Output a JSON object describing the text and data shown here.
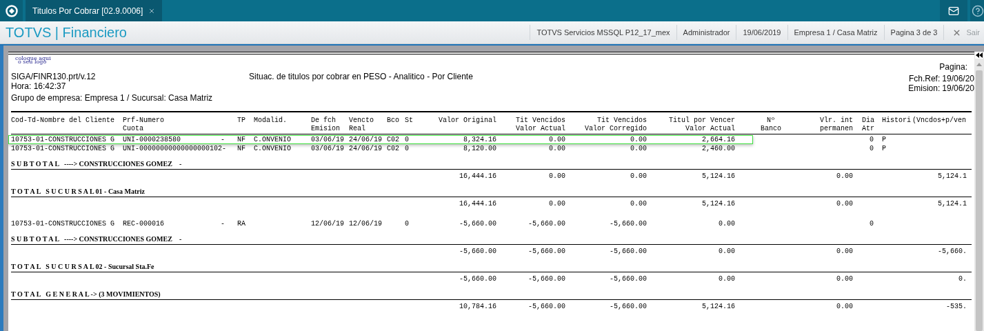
{
  "top_bar": {
    "tabs": [
      {
        "label": "Titulos Por Cobrar [02.9.0006]",
        "selected": true
      }
    ]
  },
  "header_bar": {
    "module_title": "TOTVS | Financiero",
    "info_items": [
      "TOTVS Servicios MSSQL P12_17_mex",
      "Administrador",
      "19/06/2019",
      "Empresa 1 / Casa Matriz",
      "Pagina 3 de 3"
    ],
    "exit_label": "Sair"
  },
  "report": {
    "logo_lines": [
      "coloque aqui",
      "o seu logo"
    ],
    "header_left": [
      "SIGA/FINR130.prt/v.12",
      "Hora: 16:42:37",
      "Grupo de empresa: Empresa 1 / Sucursal: Casa Matriz"
    ],
    "title": "Situac. de titulos por cobrar en PESO - Analitico - Por Cliente",
    "header_right": [
      {
        "label": "Pagina:"
      },
      {
        "label": "Fch.Ref:",
        "value": "19/06/20"
      },
      {
        "label": "Emision:",
        "value": "19/06/20"
      }
    ],
    "columns": [
      [
        "Cod-Td-Nombre del Cliente"
      ],
      [
        "Prf-Numero",
        "Cuota"
      ],
      null,
      [
        "TP"
      ],
      [
        "Modalid."
      ],
      [
        "De fch",
        "Emision"
      ],
      [
        "Vencto",
        "Real"
      ],
      [
        "Bco"
      ],
      [
        "St"
      ],
      [
        "Valor Original"
      ],
      [
        "Tit Vencidos",
        "Valor Actual"
      ],
      [
        "Tit Vencidos",
        "Valor Corregido"
      ],
      [
        "Titul por Vencer",
        "Valor Actual"
      ],
      [
        "Nº",
        "Banco"
      ],
      [
        "Vlr. int",
        "permanen"
      ],
      [
        "Dia",
        "Atr"
      ],
      [
        "Histori"
      ],
      [
        "(Vncdos+p/ven"
      ]
    ],
    "lines": [
      {
        "kind": "detail",
        "selected": true,
        "cells": [
          "10753-01-CONSTRUCCIONES G",
          "UNI-0000238580",
          "-",
          "NF",
          "C.ONVENIO",
          "03/06/19",
          "24/06/19",
          "C02",
          "0",
          "8,324.16",
          "0.00",
          "0.00",
          "2,664.16",
          null,
          null,
          "0",
          "P",
          null
        ]
      },
      {
        "kind": "detail",
        "selected": false,
        "cells": [
          "10753-01-CONSTRUCCIONES G",
          "UNI-00000000000000000102-",
          null,
          "NF",
          "C.ONVENIO",
          "03/06/19",
          "24/06/19",
          "C02",
          "0",
          "8,120.00",
          "0.00",
          "0.00",
          "2,460.00",
          null,
          null,
          "0",
          "P",
          null
        ]
      },
      {
        "kind": "section",
        "text": "S U B T O T A L   ----> CONSTRUCCIONES GOMEZ    -"
      },
      {
        "kind": "totals",
        "cells": [
          null,
          null,
          null,
          null,
          null,
          null,
          null,
          null,
          null,
          "16,444.16",
          "0.00",
          "0.00",
          "5,124.16",
          null,
          "0.00",
          null,
          null,
          "5,124.1"
        ]
      },
      {
        "kind": "section",
        "text": "T O T A L   S U C U R S A L 01 - Casa Matriz"
      },
      {
        "kind": "totals",
        "cells": [
          null,
          null,
          null,
          null,
          null,
          null,
          null,
          null,
          null,
          "16,444.16",
          "0.00",
          "0.00",
          "5,124.16",
          null,
          "0.00",
          null,
          null,
          "5,124.1"
        ]
      },
      {
        "kind": "detail",
        "selected": false,
        "cells": [
          "10753-01-CONSTRUCCIONES G",
          "REC-000016",
          "-",
          "RA",
          null,
          "12/06/19",
          "12/06/19",
          null,
          "0",
          "-5,660.00",
          "-5,660.00",
          "-5,660.00",
          "0.00",
          null,
          null,
          "0",
          null,
          null
        ]
      },
      {
        "kind": "section",
        "text": "S U B T O T A L   ----> CONSTRUCCIONES GOMEZ    -"
      },
      {
        "kind": "totals",
        "cells": [
          null,
          null,
          null,
          null,
          null,
          null,
          null,
          null,
          null,
          "-5,660.00",
          "-5,660.00",
          "-5,660.00",
          "0.00",
          null,
          "0.00",
          null,
          null,
          "-5,660."
        ]
      },
      {
        "kind": "section",
        "text": "T O T A L   S U C U R S A L 02 - Sucursal Sta.Fe"
      },
      {
        "kind": "totals",
        "cells": [
          null,
          null,
          null,
          null,
          null,
          null,
          null,
          null,
          null,
          "-5,660.00",
          "-5,660.00",
          "-5,660.00",
          "0.00",
          null,
          "0.00",
          null,
          null,
          "0."
        ]
      },
      {
        "kind": "section",
        "text": "T O T A L   G E N E R A L -> (3 MOVIMIENTOS)"
      },
      {
        "kind": "totals",
        "cells": [
          null,
          null,
          null,
          null,
          null,
          null,
          null,
          null,
          null,
          "10,784.16",
          "-5,660.00",
          "-5,660.00",
          "5,124.16",
          null,
          "0.00",
          null,
          null,
          "-535."
        ]
      }
    ]
  }
}
